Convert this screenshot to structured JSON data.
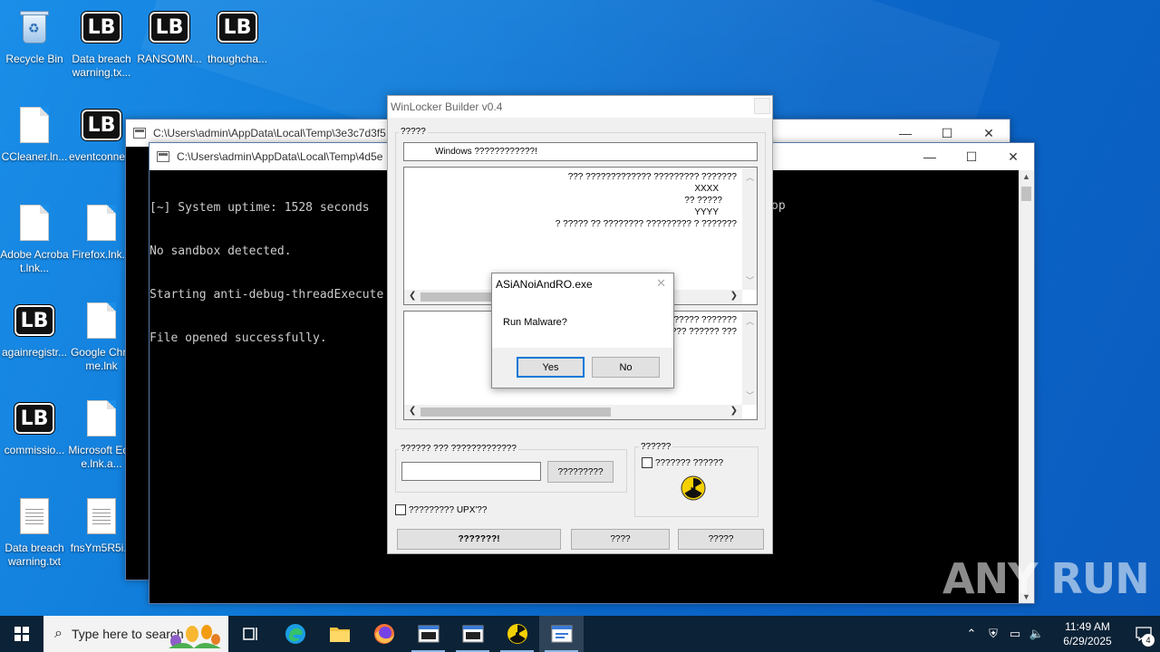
{
  "desktop": {
    "icons": [
      {
        "label": "Recycle Bin",
        "kind": "recycle-bin-icon"
      },
      {
        "label": "Data breach warning.tx...",
        "kind": "lockbit-icon"
      },
      {
        "label": "RANSOMN...",
        "kind": "lockbit-icon"
      },
      {
        "label": "thoughcha...",
        "kind": "lockbit-icon"
      },
      {
        "label": "CCleaner.ln...",
        "kind": "document-icon"
      },
      {
        "label": "eventconne...",
        "kind": "lockbit-icon"
      },
      {
        "label": "Adobe Acrobat.lnk...",
        "kind": "document-icon"
      },
      {
        "label": "Firefox.lnk...",
        "kind": "document-icon"
      },
      {
        "label": "againregistr...",
        "kind": "lockbit-icon"
      },
      {
        "label": "Google Chrome.lnk",
        "kind": "document-icon"
      },
      {
        "label": "commissio...",
        "kind": "lockbit-icon"
      },
      {
        "label": "Microsoft Edge.lnk.a...",
        "kind": "document-icon"
      },
      {
        "label": "Data breach warning.txt",
        "kind": "text-file-icon"
      },
      {
        "label": "fnsYm5R5i...",
        "kind": "text-file-icon"
      }
    ],
    "watermark": "ANY RUN"
  },
  "console_back": {
    "title": "C:\\Users\\admin\\AppData\\Local\\Temp\\3e3c7d3f5",
    "min": "—",
    "max": "☐",
    "close": "✕"
  },
  "console_front": {
    "title": "C:\\Users\\admin\\AppData\\Local\\Temp\\4d5e",
    "lines": [
      "[~] System uptime: 1528 seconds",
      "No sandbox detected.",
      "Starting anti-debug-threadExecute",
      "File opened successfully."
    ],
    "overflow_text": "op",
    "min": "—",
    "max": "☐",
    "close": "✕"
  },
  "builder": {
    "title": "WinLocker Builder v0.4",
    "group1_label": "?????",
    "header_field": "Windows ????????????!",
    "memo1_lines": [
      "??? ????????????? ????????? ???????",
      "XXXX",
      "?? ?????",
      "YYYY",
      "? ????? ?? ???????? ????????? ? ???????"
    ],
    "memo2_lines": [
      "????? ???????",
      "??? ?????? ???"
    ],
    "group2_label": "?????? ??? ?????????????",
    "code_input": "",
    "apply_button": "?????????",
    "group3_label": "??????",
    "check_label": "??????? ??????",
    "upx_label": "????????? UPX'??",
    "build_button": "???????!",
    "test_button": "????",
    "exit_button": "?????"
  },
  "msgbox": {
    "title": "ASiANoiAndRO.exe",
    "text": "Run Malware?",
    "yes": "Yes",
    "no": "No",
    "close": "✕"
  },
  "taskbar": {
    "search_placeholder": "Type here to search",
    "time": "11:49 AM",
    "date": "6/29/2025",
    "notification_count": "4"
  }
}
